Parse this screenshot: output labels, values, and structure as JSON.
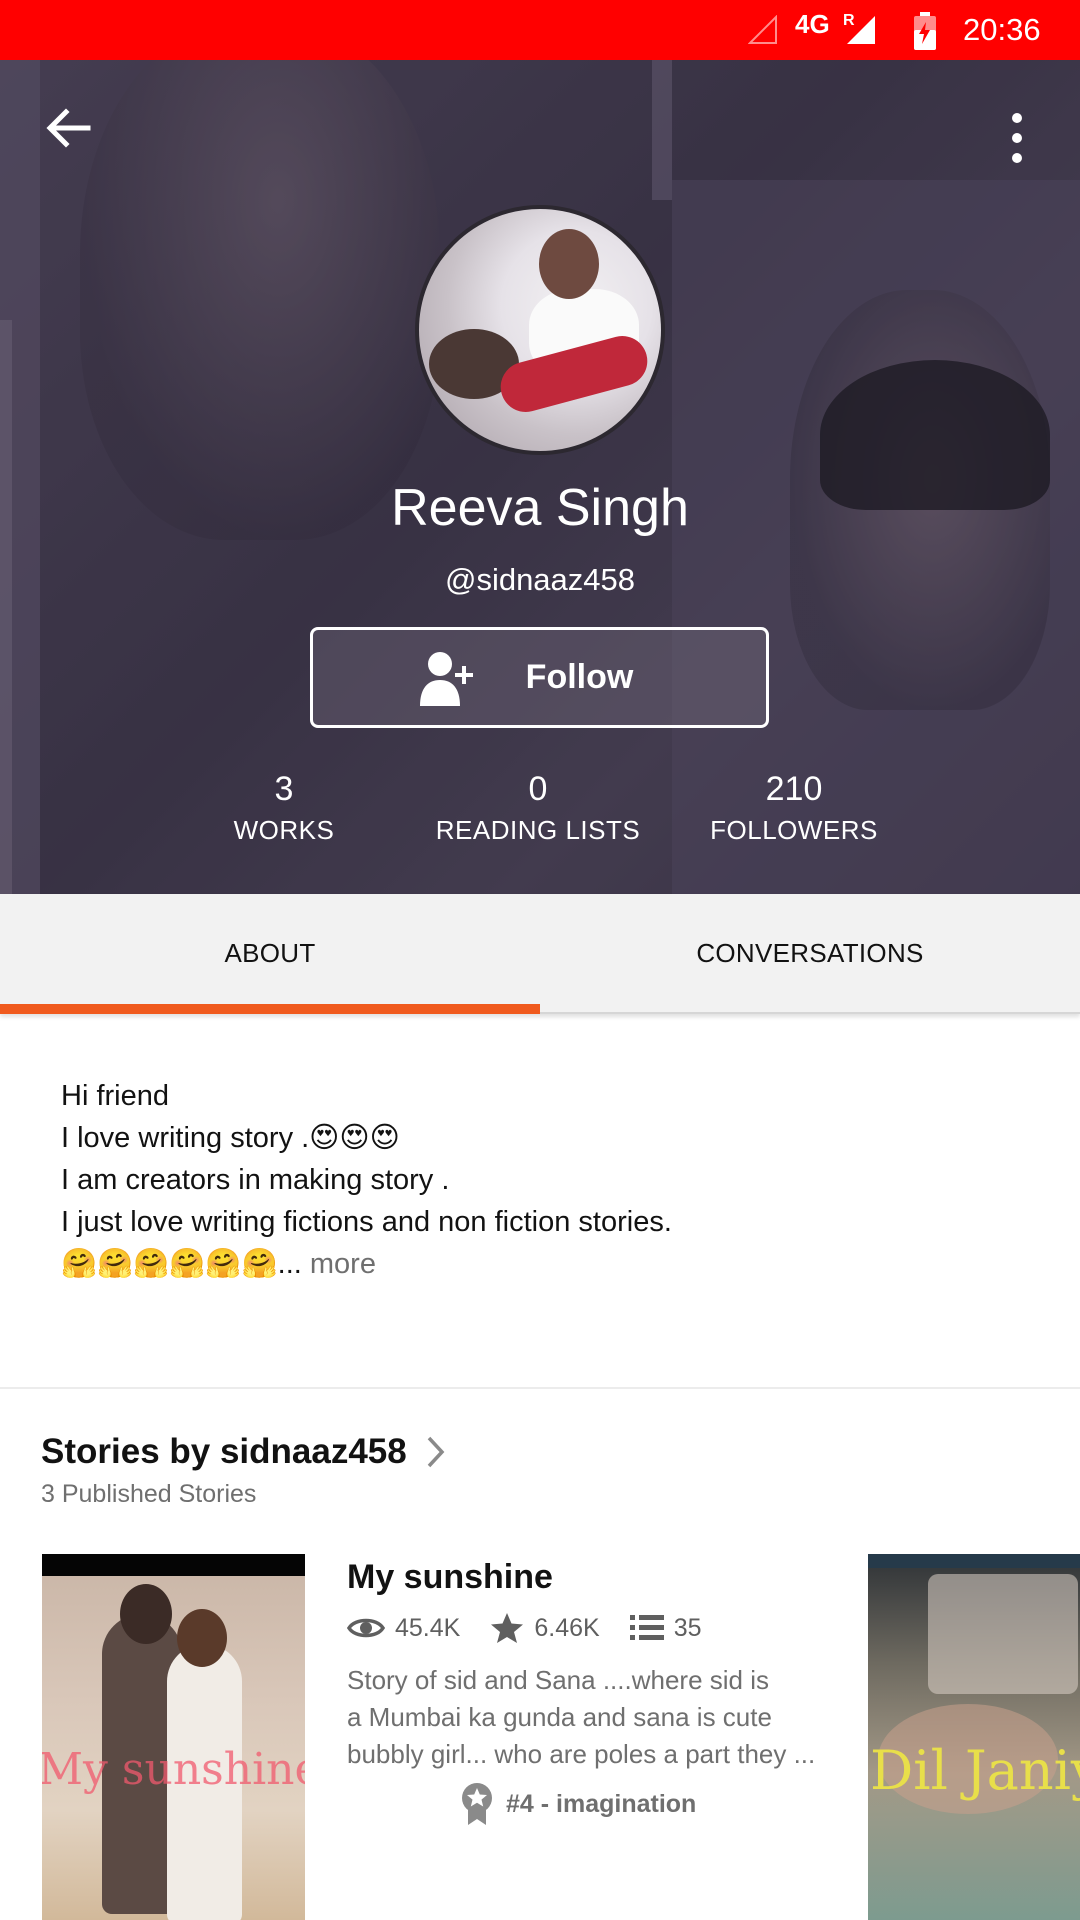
{
  "status_bar": {
    "network": "4G",
    "roaming": "R",
    "time": "20:36"
  },
  "profile": {
    "display_name": "Reeva Singh",
    "username": "@sidnaaz458",
    "follow_label": "Follow",
    "stats": [
      {
        "value": "3",
        "label": "WORKS"
      },
      {
        "value": "0",
        "label": "READING LISTS"
      },
      {
        "value": "210",
        "label": "FOLLOWERS"
      }
    ]
  },
  "tabs": [
    {
      "label": "ABOUT",
      "active": true
    },
    {
      "label": "CONVERSATIONS",
      "active": false
    }
  ],
  "about": {
    "lines": [
      "Hi friend",
      "I love writing story .😍😍😍",
      "I am creators in making story .",
      "I just love writing fictions and non fiction stories.",
      "🤗🤗🤗🤗🤗🤗..."
    ],
    "more_label": " more"
  },
  "stories": {
    "title": "Stories by sidnaaz458",
    "count": "3 Published Stories",
    "items": [
      {
        "cover_text": "My sunshine",
        "title": "My sunshine",
        "reads": "45.4K",
        "votes": "6.46K",
        "parts": "35",
        "description_lines": [
          "Story of sid and Sana ....where sid is",
          "a Mumbai ka gunda and sana is cute",
          "bubbly girl... who are poles a part they ..."
        ],
        "rank": "#4 - imagination"
      },
      {
        "cover_text": "Dil Janiy"
      }
    ]
  },
  "colors": {
    "status_bar": "#ff0000",
    "accent": "#f05a1e",
    "tab_bg": "#f2f2f2",
    "hero_tint": "#4a4256"
  },
  "icons": [
    "back-arrow-icon",
    "more-vert-icon",
    "add-user-icon",
    "chevron-right-icon",
    "eye-icon",
    "star-icon",
    "list-icon",
    "award-icon",
    "signal-icon",
    "battery-charging-icon"
  ]
}
